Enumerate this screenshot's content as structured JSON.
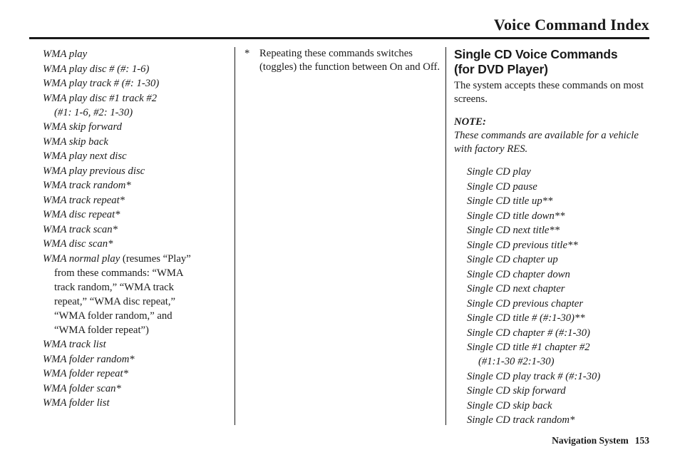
{
  "header": {
    "title": "Voice Command Index"
  },
  "footer": {
    "system": "Navigation System",
    "page_number": "153"
  },
  "left_column": {
    "commands": [
      {
        "lines": [
          "WMA play"
        ]
      },
      {
        "lines": [
          "WMA play disc # (#: 1-6)"
        ]
      },
      {
        "lines": [
          "WMA play track # (#: 1-30)"
        ]
      },
      {
        "lines": [
          "WMA play disc #1 track #2",
          "(#1: 1-6, #2: 1-30)"
        ]
      },
      {
        "lines": [
          "WMA skip forward"
        ]
      },
      {
        "lines": [
          "WMA skip back"
        ]
      },
      {
        "lines": [
          "WMA play next disc"
        ]
      },
      {
        "lines": [
          "WMA play previous disc"
        ]
      },
      {
        "lines": [
          "WMA track random*"
        ]
      },
      {
        "lines": [
          "WMA track repeat*"
        ]
      },
      {
        "lines": [
          "WMA disc repeat*"
        ]
      },
      {
        "lines": [
          "WMA track scan*"
        ]
      },
      {
        "lines": [
          "WMA disc scan*"
        ]
      },
      {
        "italic": "WMA normal play",
        "roman": " (resumes “Play”",
        "lines": [
          "from these commands: “WMA",
          "track random,” “WMA track",
          "repeat,” “WMA disc repeat,”",
          "“WMA folder random,” and",
          "“WMA folder repeat”)"
        ],
        "roman_continuation": true
      },
      {
        "lines": [
          "WMA track list"
        ]
      },
      {
        "lines": [
          "WMA folder random*"
        ]
      },
      {
        "lines": [
          "WMA folder repeat*"
        ]
      },
      {
        "lines": [
          "WMA folder scan*"
        ]
      },
      {
        "lines": [
          "WMA folder list"
        ]
      }
    ]
  },
  "middle_column": {
    "footnote": {
      "marker": "*",
      "text": "Repeating these commands switches (toggles) the function between On and Off."
    }
  },
  "right_column": {
    "heading_line1": "Single CD Voice Commands",
    "heading_line2": "(for DVD Player)",
    "intro": "The system accepts these commands on most screens.",
    "note_label": "NOTE:",
    "note_text": "These commands are available for a vehicle with factory RES.",
    "commands": [
      {
        "lines": [
          "Single CD play"
        ]
      },
      {
        "lines": [
          "Single CD pause"
        ]
      },
      {
        "lines": [
          "Single CD title up**"
        ]
      },
      {
        "lines": [
          "Single CD title down**"
        ]
      },
      {
        "lines": [
          "Single CD next title**"
        ]
      },
      {
        "lines": [
          "Single CD previous title**"
        ]
      },
      {
        "lines": [
          "Single CD chapter up"
        ]
      },
      {
        "lines": [
          "Single CD chapter down"
        ]
      },
      {
        "lines": [
          "Single CD next chapter"
        ]
      },
      {
        "lines": [
          "Single CD previous chapter"
        ]
      },
      {
        "lines": [
          "Single CD title # (#:1-30)**"
        ]
      },
      {
        "lines": [
          "Single CD chapter # (#:1-30)"
        ]
      },
      {
        "lines": [
          "Single CD title #1 chapter #2",
          "(#1:1-30 #2:1-30)"
        ]
      },
      {
        "lines": [
          "Single CD play track # (#:1-30)"
        ]
      },
      {
        "lines": [
          "Single CD skip forward"
        ]
      },
      {
        "lines": [
          "Single CD skip back"
        ]
      },
      {
        "lines": [
          "Single CD track random*"
        ]
      }
    ]
  }
}
